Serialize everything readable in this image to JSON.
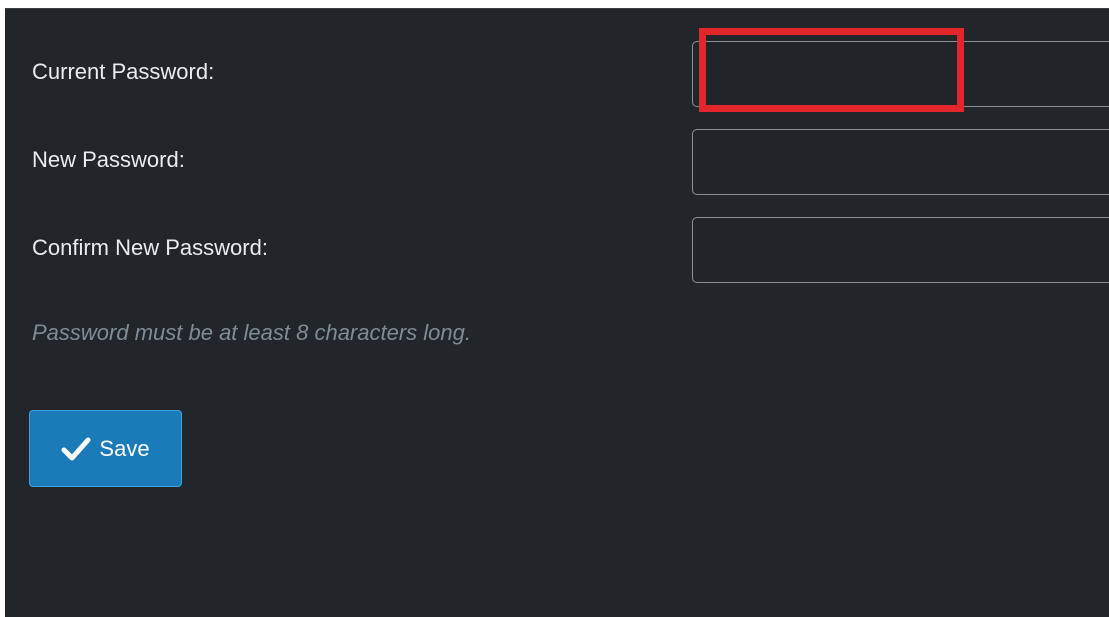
{
  "form": {
    "fields": [
      {
        "label": "Current Password:",
        "value": "",
        "placeholder": ""
      },
      {
        "label": "New Password:",
        "value": "",
        "placeholder": ""
      },
      {
        "label": "Confirm New Password:",
        "value": "",
        "placeholder": ""
      }
    ],
    "hint": "Password must be at least 8 characters long.",
    "save_button": {
      "label": "Save",
      "icon": "checkmark-icon"
    }
  },
  "colors": {
    "panel_bg": "#22262a",
    "highlight": "#e3262a",
    "button_bg": "#1b7bb8",
    "hint_text": "#7f8c95"
  }
}
